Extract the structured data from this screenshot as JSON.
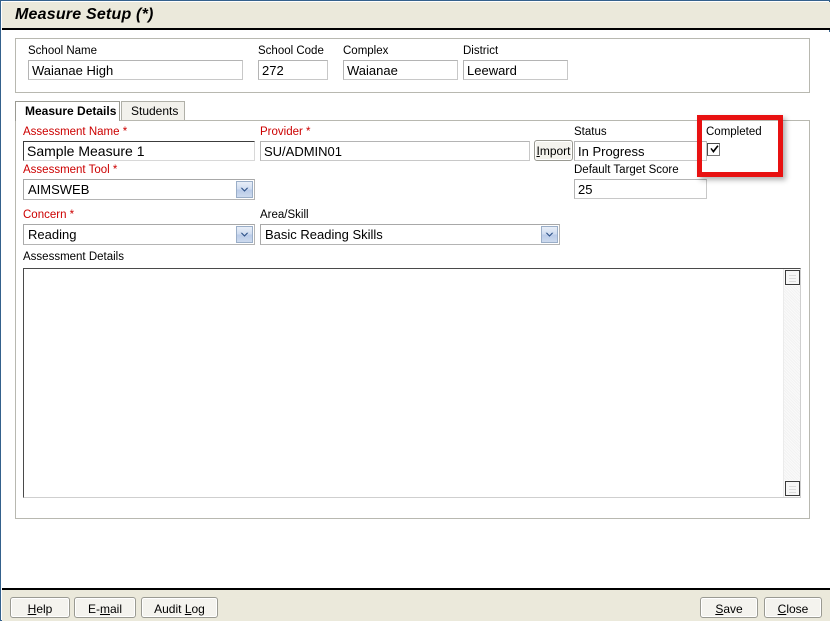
{
  "window": {
    "title": "Measure Setup (*)"
  },
  "school_panel": {
    "fields": [
      {
        "label": "School Name",
        "value": "Waianae High"
      },
      {
        "label": "School Code",
        "value": "272"
      },
      {
        "label": "Complex",
        "value": "Waianae"
      },
      {
        "label": "District",
        "value": "Leeward"
      }
    ]
  },
  "tabs": [
    {
      "label": "Measure Details",
      "active": true
    },
    {
      "label": "Students",
      "active": false
    }
  ],
  "form": {
    "assessment_name": {
      "label": "Assessment Name",
      "required_marker": "*",
      "value": "Sample Measure 1"
    },
    "assessment_tool": {
      "label": "Assessment Tool",
      "required_marker": "*",
      "value": "AIMSWEB"
    },
    "concern": {
      "label": "Concern",
      "required_marker": "*",
      "value": "Reading"
    },
    "provider": {
      "label": "Provider",
      "required_marker": "*",
      "value": "SU/ADMIN01"
    },
    "import_button": {
      "label": "Import",
      "mnemonic": "I",
      "rest": "mport"
    },
    "status": {
      "label": "Status",
      "value": "In Progress"
    },
    "default_target_score": {
      "label": "Default Target Score",
      "value": "25"
    },
    "completed": {
      "label": "Completed",
      "checked": true
    },
    "area_skill": {
      "label": "Area/Skill",
      "value": "Basic Reading Skills"
    },
    "assessment_details": {
      "label": "Assessment Details",
      "value": ""
    }
  },
  "annotation": {
    "color": "#e81111",
    "target": "Completed"
  },
  "bottom_bar": {
    "left_buttons": [
      {
        "label": "Help",
        "pre": "",
        "mnemonic": "H",
        "post": "elp"
      },
      {
        "label": "E-mail",
        "pre": "E-",
        "mnemonic": "m",
        "post": "ail"
      },
      {
        "label": "Audit Log",
        "pre": "Audit ",
        "mnemonic": "L",
        "post": "og"
      }
    ],
    "right_buttons": [
      {
        "label": "Save",
        "pre": "",
        "mnemonic": "S",
        "post": "ave"
      },
      {
        "label": "Close",
        "pre": "",
        "mnemonic": "C",
        "post": "lose"
      }
    ]
  }
}
